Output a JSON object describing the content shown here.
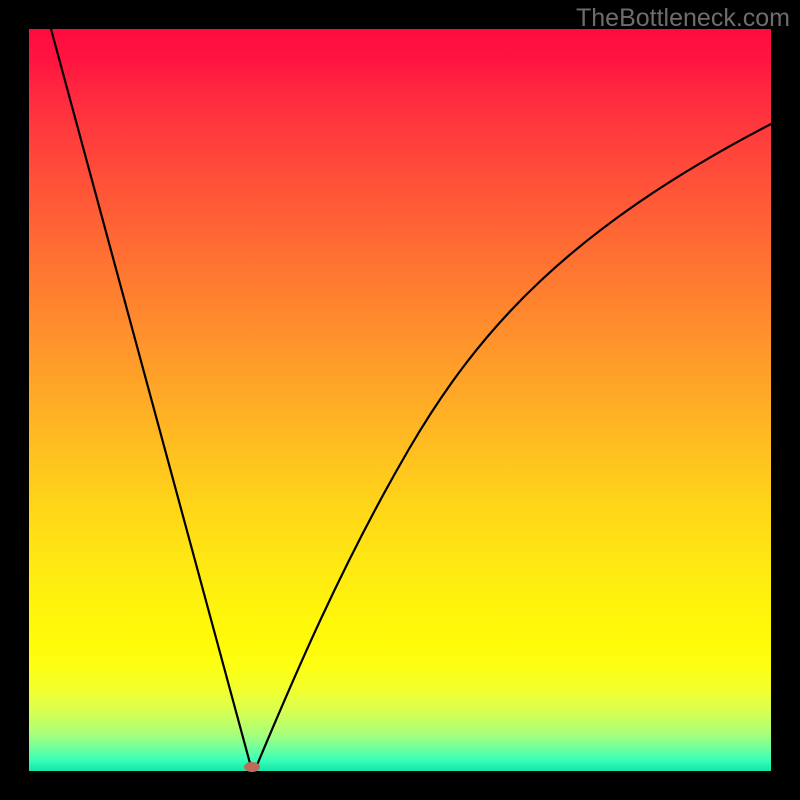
{
  "watermark": "TheBottleneck.com",
  "colors": {
    "frame": "#000000",
    "curve": "#000000",
    "marker": "#c06a5a"
  },
  "chart_data": {
    "type": "line",
    "title": "",
    "xlabel": "",
    "ylabel": "",
    "xlim": [
      0,
      100
    ],
    "ylim": [
      0,
      100
    ],
    "note": "Axes are abstract (0–100 in each direction, no ticks or labels shown). The curve is a V-shaped bottleneck curve reaching its minimum near x≈30. Values are read off the plot as percentages of the plot height from bottom.",
    "minimum": {
      "x": 30,
      "y": 0.5
    },
    "series": [
      {
        "name": "bottleneck-curve",
        "x": [
          3,
          6,
          9,
          12,
          15,
          18,
          21,
          24,
          26,
          28,
          29,
          30,
          31,
          32,
          34,
          37,
          40,
          45,
          50,
          55,
          60,
          65,
          70,
          75,
          80,
          85,
          90,
          95,
          100
        ],
        "values": [
          100,
          89,
          78,
          67,
          56,
          45,
          34,
          22,
          15,
          7,
          3,
          0.5,
          3,
          7,
          15,
          25,
          33,
          44,
          53,
          60,
          66,
          71,
          75,
          78,
          81,
          83,
          85,
          87,
          88
        ]
      }
    ]
  }
}
